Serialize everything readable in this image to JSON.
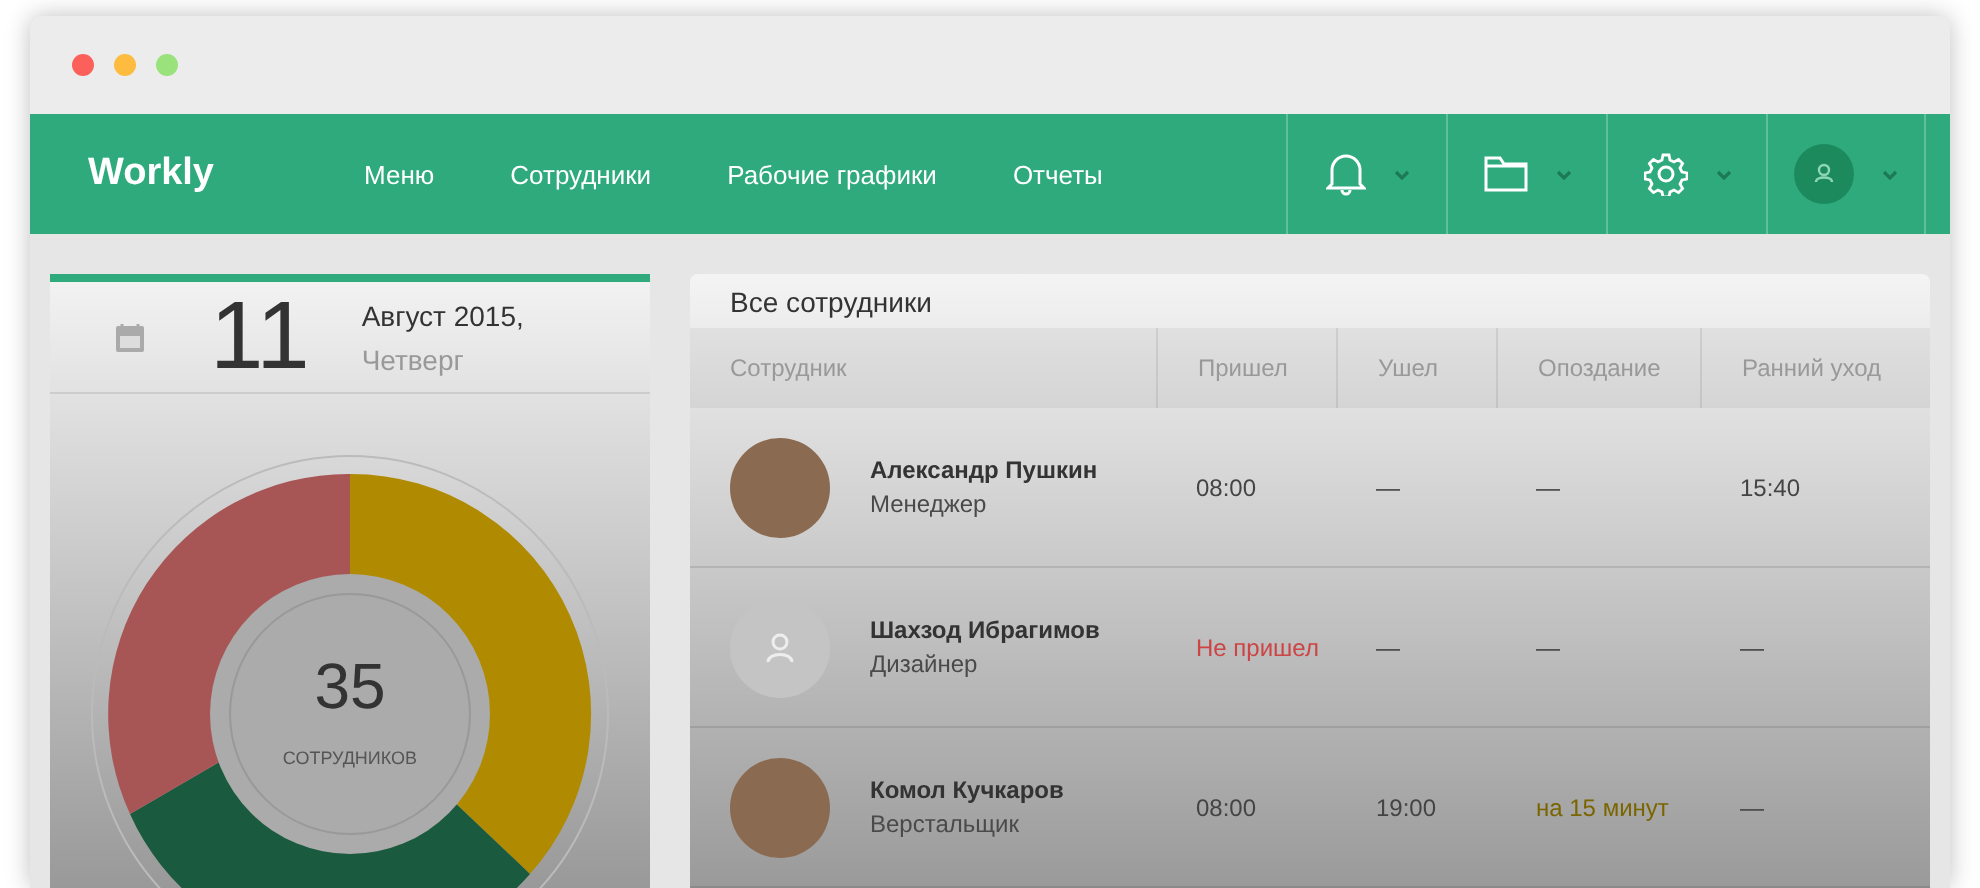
{
  "nav": {
    "brand": "Workly",
    "menu": [
      {
        "label": "Меню"
      },
      {
        "label": "Сотрудники"
      },
      {
        "label": "Рабочие графики"
      },
      {
        "label": "Отчеты"
      }
    ],
    "tools": [
      {
        "kind": "bell"
      },
      {
        "kind": "folder"
      },
      {
        "kind": "gear"
      },
      {
        "kind": "avatar"
      }
    ]
  },
  "date": {
    "day": "11",
    "month": "Август 2015,",
    "weekday": "Четверг"
  },
  "summary": {
    "total": "35",
    "label": "СОТРУДНИКОВ"
  },
  "table": {
    "title": "Все сотрудники",
    "columns": [
      "Сотрудник",
      "Пришел",
      "Ушел",
      "Опоздание",
      "Ранний уход"
    ],
    "rows": [
      {
        "cells": [
          {
            "kind": "employee",
            "name": "Александр Пушкин",
            "role": "Менеджер",
            "avatar": {
              "kind": "photo"
            }
          },
          {
            "text": "08:00",
            "kind": "normal"
          },
          {
            "text": "—",
            "kind": "normal"
          },
          {
            "text": "—",
            "kind": "normal"
          },
          {
            "text": "15:40",
            "kind": "normal"
          }
        ]
      },
      {
        "cells": [
          {
            "kind": "employee",
            "name": "Шахзод Ибрагимов",
            "role": "Дизайнер",
            "avatar": {
              "kind": "placeholder"
            }
          },
          {
            "text": "Не пришел",
            "kind": "absent"
          },
          {
            "text": "—",
            "kind": "normal"
          },
          {
            "text": "—",
            "kind": "normal"
          },
          {
            "text": "—",
            "kind": "normal"
          }
        ]
      },
      {
        "cells": [
          {
            "kind": "employee",
            "name": "Комол Кучкаров",
            "role": "Верстальщик",
            "avatar": {
              "kind": "photo"
            }
          },
          {
            "text": "08:00",
            "kind": "normal"
          },
          {
            "text": "19:00",
            "kind": "normal"
          },
          {
            "text": "на 15 минут",
            "kind": "late"
          },
          {
            "text": "—",
            "kind": "normal"
          }
        ]
      }
    ]
  }
}
